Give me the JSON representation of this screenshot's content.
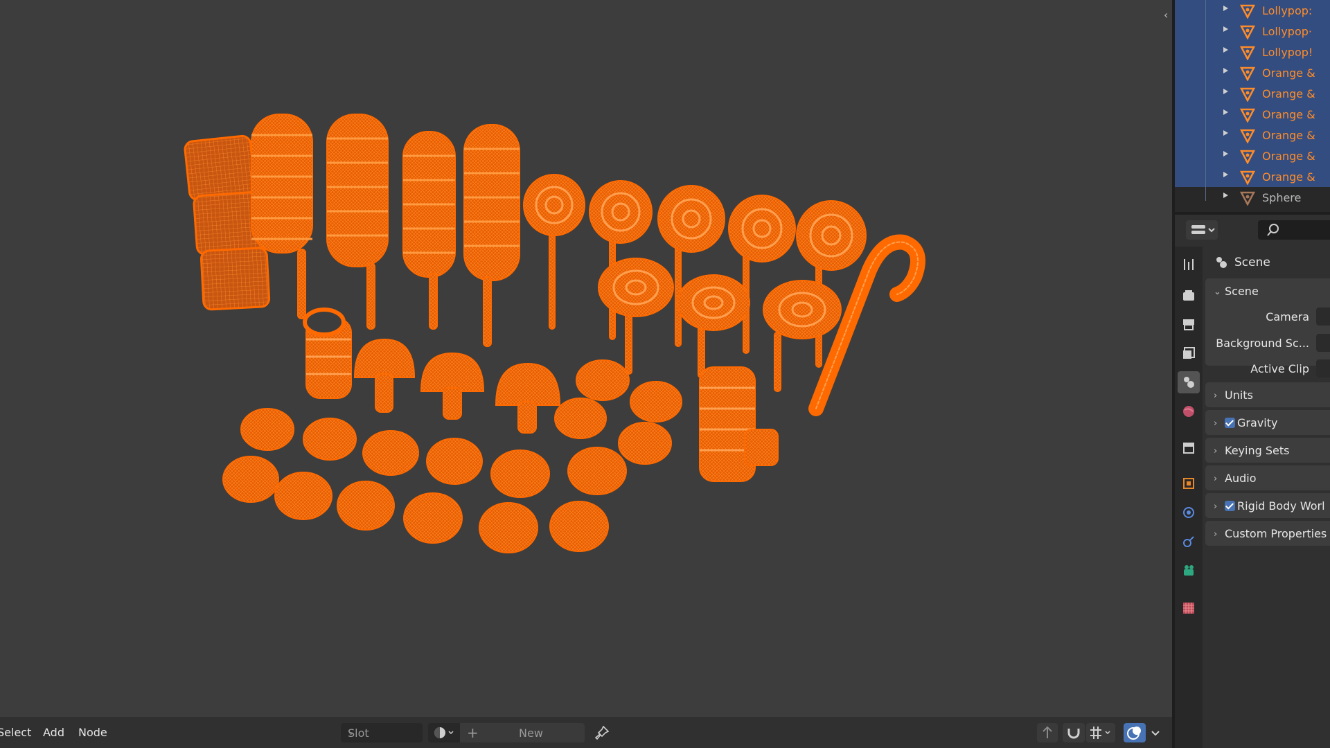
{
  "outliner": {
    "items": [
      {
        "label": "Lollypop:",
        "selected": true
      },
      {
        "label": "Lollypop·",
        "selected": true
      },
      {
        "label": "Lollypop!",
        "selected": true
      },
      {
        "label": "Orange &",
        "selected": true
      },
      {
        "label": "Orange &",
        "selected": true
      },
      {
        "label": "Orange &",
        "selected": true
      },
      {
        "label": "Orange &",
        "selected": true
      },
      {
        "label": "Orange &",
        "selected": true
      },
      {
        "label": "Orange &",
        "selected": true
      },
      {
        "label": "Sphere",
        "selected": false
      }
    ]
  },
  "properties": {
    "context_title": "Scene",
    "scene_panel": {
      "title": "Scene",
      "rows": [
        "Camera",
        "Background Sc...",
        "Active Clip"
      ]
    },
    "panels": [
      {
        "title": "Units",
        "checkbox": false
      },
      {
        "title": "Gravity",
        "checkbox": true
      },
      {
        "title": "Keying Sets",
        "checkbox": false
      },
      {
        "title": "Audio",
        "checkbox": false
      },
      {
        "title": "Rigid Body Worl",
        "checkbox": true
      },
      {
        "title": "Custom Properties",
        "checkbox": false
      }
    ]
  },
  "bottombar": {
    "menu_select": "Select",
    "menu_add": "Add",
    "menu_node": "Node",
    "slot_label": "Slot",
    "new_label": "New"
  },
  "colors": {
    "wireframe_selected": "#ff6a00",
    "outliner_selected_bg": "#334d80",
    "accent_blue": "#4772b3"
  },
  "icons": {
    "outliner_item": "mesh-triangle-icon",
    "collapse": "chevron-left-icon",
    "search": "search-icon",
    "pin": "pin-icon"
  }
}
